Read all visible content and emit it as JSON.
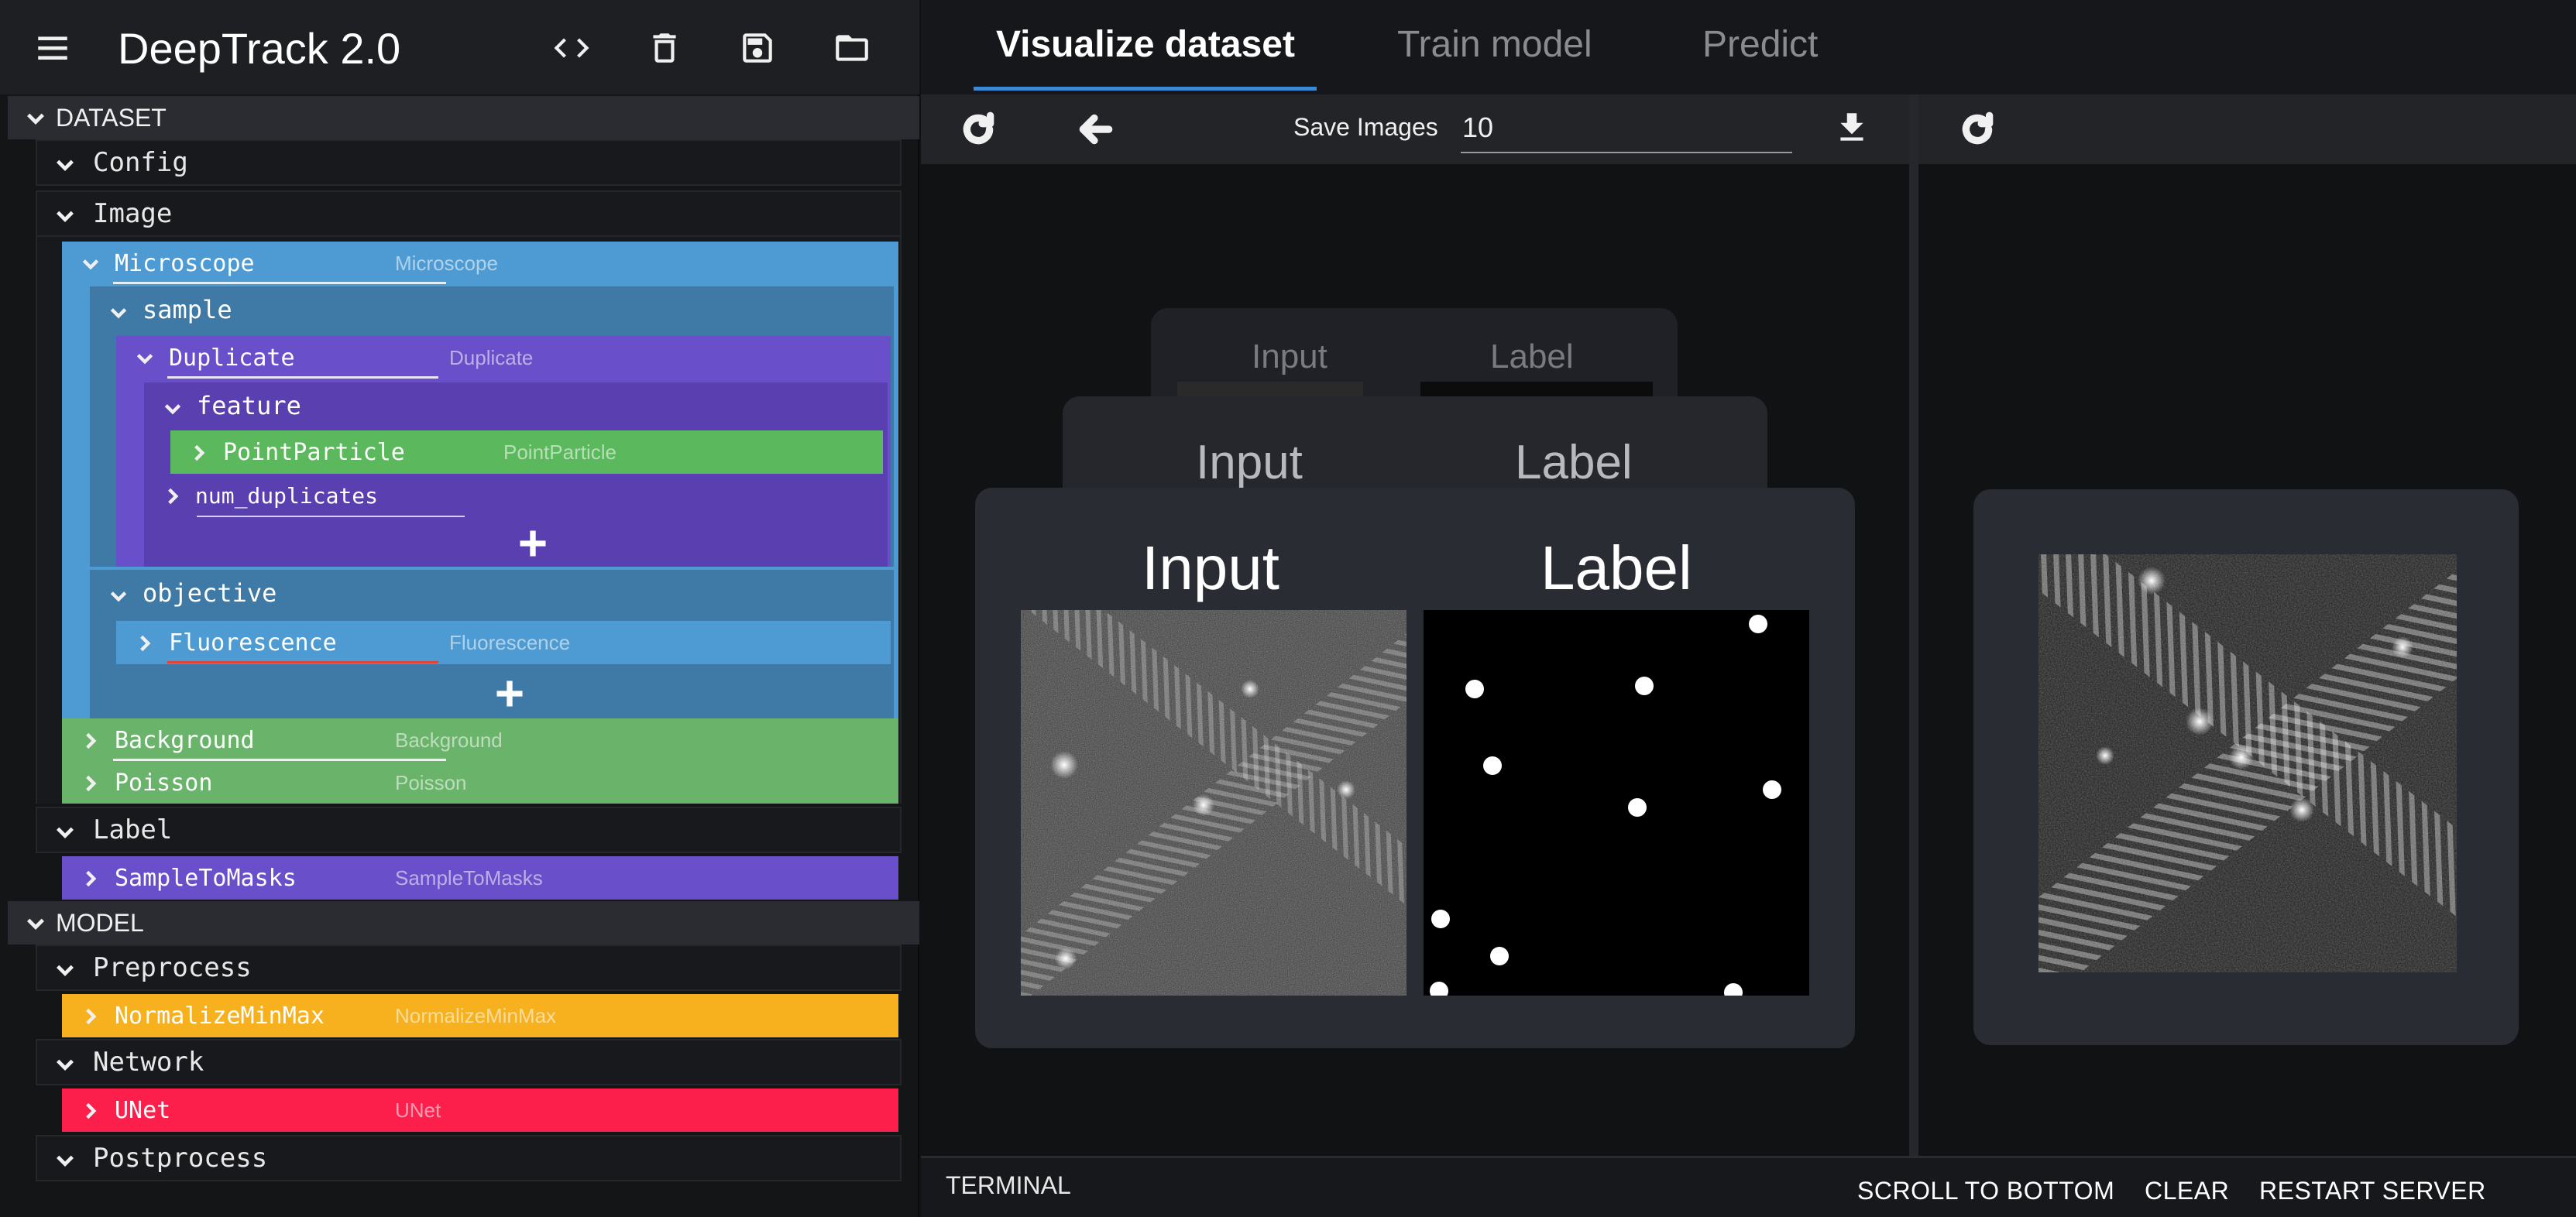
{
  "app": {
    "title": "DeepTrack 2.0"
  },
  "tabs": [
    {
      "label": "Visualize dataset",
      "active": true
    },
    {
      "label": "Train model",
      "active": false
    },
    {
      "label": "Predict",
      "active": false
    }
  ],
  "toolbar": {
    "save_label": "Save Images",
    "save_value": "10"
  },
  "tree": {
    "dataset_label": "DATASET",
    "model_label": "MODEL",
    "config": "Config",
    "image": "Image",
    "label_group": "Label",
    "preprocess": "Preprocess",
    "network": "Network",
    "postprocess": "Postprocess",
    "microscope": {
      "name": "Microscope",
      "type": "Microscope"
    },
    "sample": "sample",
    "duplicate": {
      "name": "Duplicate",
      "type": "Duplicate"
    },
    "feature": "feature",
    "point_particle": {
      "name": "PointParticle",
      "type": "PointParticle"
    },
    "num_duplicates": "num_duplicates",
    "objective": "objective",
    "fluorescence": {
      "name": "Fluorescence",
      "type": "Fluorescence"
    },
    "background": {
      "name": "Background",
      "type": "Background"
    },
    "poisson": {
      "name": "Poisson",
      "type": "Poisson"
    },
    "sample_to_masks": {
      "name": "SampleToMasks",
      "type": "SampleToMasks"
    },
    "normalize": {
      "name": "NormalizeMinMax",
      "type": "NormalizeMinMax"
    },
    "unet": {
      "name": "UNet",
      "type": "UNet"
    }
  },
  "cards": {
    "input_label": "Input",
    "label_label": "Label"
  },
  "terminal": {
    "title": "TERMINAL",
    "scroll": "SCROLL TO BOTTOM",
    "clear": "CLEAR",
    "restart": "RESTART SERVER"
  },
  "colors": {
    "blue": "#4e9bd3",
    "steel": "#3f7aa6",
    "purple": "#6a4fcb",
    "deep_purple": "#5a3fb0",
    "green": "#5cb85c",
    "green_bg": "#6ab36a",
    "orange": "#f7b11f",
    "red": "#fc1f4c",
    "accent": "#3b8ad8"
  },
  "icons": [
    "menu-icon",
    "code-icon",
    "delete-icon",
    "save-icon",
    "folder-icon",
    "refresh-icon",
    "arrow-left-icon",
    "download-icon",
    "chevron-down-icon",
    "chevron-right-icon",
    "plus-icon"
  ]
}
